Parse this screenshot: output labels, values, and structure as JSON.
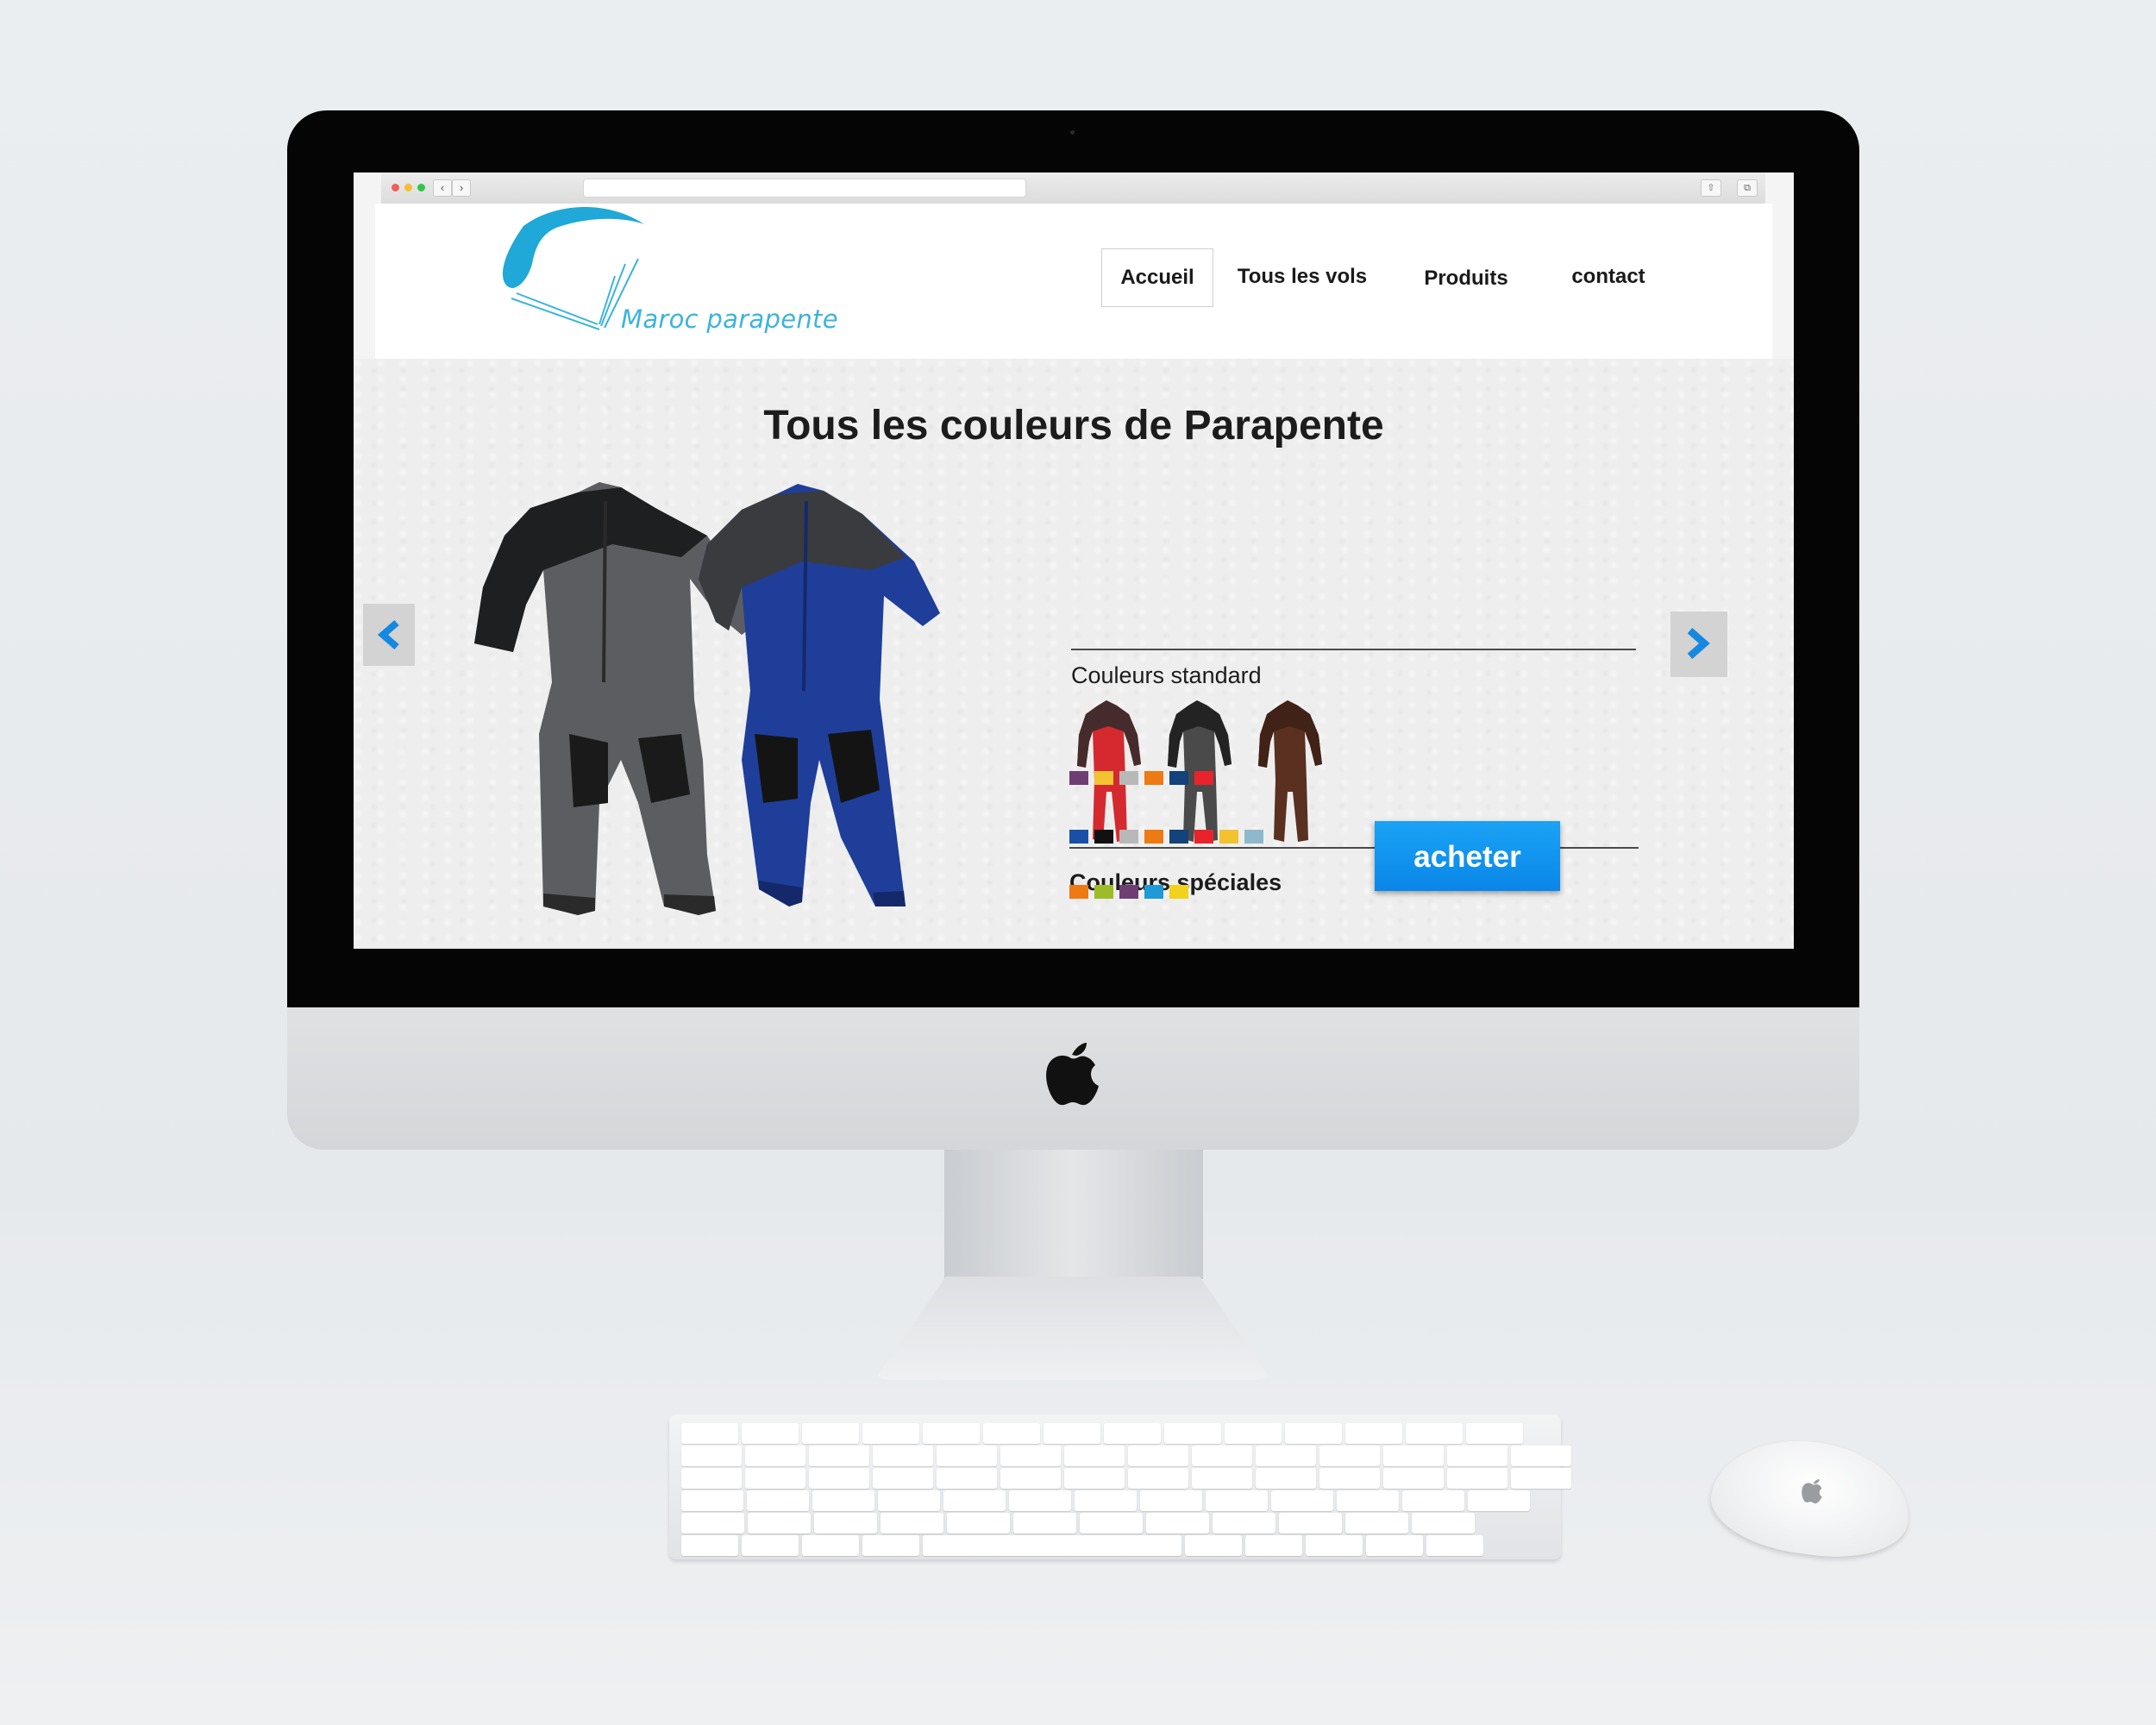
{
  "site": {
    "logo_text": "Maroc parapente",
    "nav": [
      {
        "label": "Accueil",
        "active": true
      },
      {
        "label": "Tous les vols",
        "active": false
      },
      {
        "label": "Produits",
        "active": false
      },
      {
        "label": "contact",
        "active": false
      }
    ]
  },
  "main": {
    "title": "Tous les couleurs de Parapente",
    "standard_label": "Couleurs standard",
    "special_label": "Couleurs spéciales",
    "buy_label": "acheter",
    "standard_suits": [
      {
        "body": "#d42a2f",
        "upper": "#2b2b2b"
      },
      {
        "body": "#4a4a4a",
        "upper": "#1c1c1c"
      },
      {
        "body": "#5a3020",
        "upper": "#3d2015"
      }
    ],
    "special_swatch_rows": [
      [
        "#6e3d74",
        "#f2c230",
        "#b8b8b8",
        "#ee7a14",
        "#14427a",
        "#e8232b"
      ],
      [
        "#1a4fa8",
        "#111111",
        "#b8b8b8",
        "#ee7a14",
        "#14427a",
        "#e8232b",
        "#f2c230",
        "#8fb8cc"
      ],
      [
        "#ee7a14",
        "#9cbd27",
        "#6e3d74",
        "#1f9ad6",
        "#f2d21c"
      ]
    ]
  },
  "colors": {
    "accent": "#0a8ce9",
    "logo": "#3cb4dc"
  }
}
